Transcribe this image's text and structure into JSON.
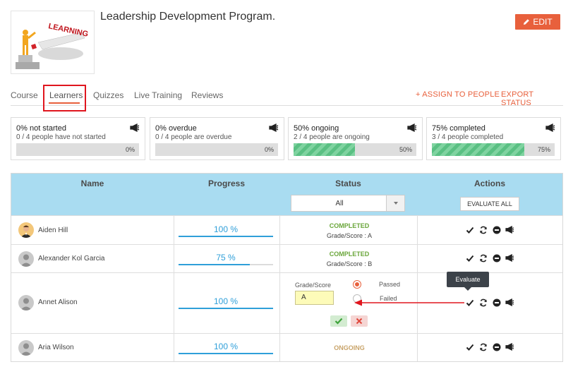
{
  "course": {
    "title": "Leadership Development Program.",
    "thumbnail_text": "LEARNING",
    "edit_label": "EDIT"
  },
  "tabs": [
    {
      "label": "Course"
    },
    {
      "label": "Learners",
      "active": true
    },
    {
      "label": "Quizzes"
    },
    {
      "label": "Live Training"
    },
    {
      "label": "Reviews"
    }
  ],
  "header_actions": {
    "assign": "+ ASSIGN TO PEOPLE",
    "export": "EXPORT STATUS"
  },
  "stats": [
    {
      "title": "0% not started",
      "sub": "0 / 4 people have not started",
      "percent": 0,
      "pct_label": "0%"
    },
    {
      "title": "0% overdue",
      "sub": "0 / 4 people are overdue",
      "percent": 0,
      "pct_label": "0%"
    },
    {
      "title": "50% ongoing",
      "sub": "2 / 4 people are ongoing",
      "percent": 50,
      "pct_label": "50%"
    },
    {
      "title": "75% completed",
      "sub": "3 / 4 people completed",
      "percent": 75,
      "pct_label": "75%"
    }
  ],
  "table": {
    "headers": {
      "name": "Name",
      "progress": "Progress",
      "status": "Status",
      "actions": "Actions"
    },
    "status_filter": "All",
    "evaluate_all": "EVALUATE ALL",
    "rows": [
      {
        "name": "Aiden Hill",
        "progress_label": "100 %",
        "progress": 100,
        "status": "COMPLETED",
        "grade": "Grade/Score : A"
      },
      {
        "name": "Alexander Kol Garcia",
        "progress_label": "75 %",
        "progress": 75,
        "status": "COMPLETED",
        "grade": "Grade/Score : B"
      },
      {
        "name": "Annet Alison",
        "progress_label": "100 %",
        "progress": 100
      },
      {
        "name": "Aria Wilson",
        "progress_label": "100 %",
        "progress": 100,
        "status": "ONGOING"
      }
    ],
    "evaluation": {
      "grade_label": "Grade/Score",
      "grade_value": "A",
      "passed_label": "Passed",
      "failed_label": "Failed",
      "selected": "Passed"
    }
  },
  "tooltip": "Evaluate",
  "colors": {
    "accent": "#e8603c",
    "completed": "#6aa63a",
    "ongoing": "#c9a46a",
    "progress": "#2f9fd9",
    "header_bg": "#a9dcf1",
    "annotation": "#e0161e"
  }
}
